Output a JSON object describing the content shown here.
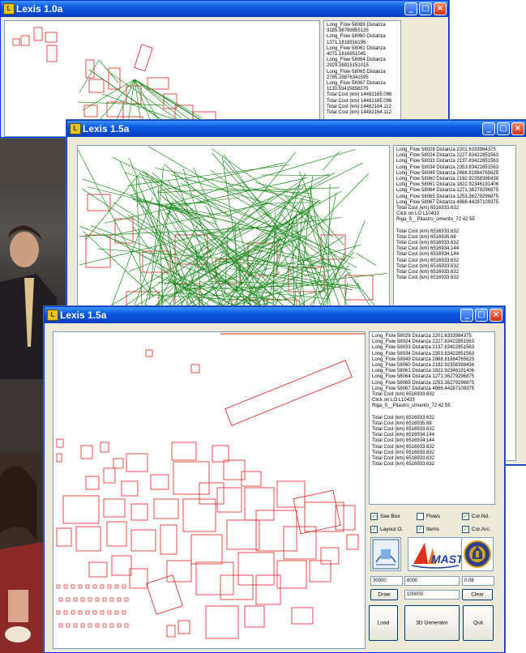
{
  "windows": {
    "w1": {
      "title": "Lexis 1.0a",
      "log": [
        "Long_Flow 58089 Distanza",
        "3185.98799855135",
        "Long_Flow 58060 Distanza",
        "1371.1818916195",
        "Long_Flow 58061 Distanza",
        "4071.1616951045",
        "Long_Flow 58064 Distanza",
        "2929.38815151015",
        "Long_Flow 58065 Distanza",
        "2785.28876341595",
        "Long_Flow 58067 Distanza",
        "1130.53415858375",
        "Total Cost (km) 14482165.096",
        "Total Cost (km) 14482165.096",
        "Total Cost (km) 14482164.112",
        "Total Cost (km) 14482164.112"
      ]
    },
    "w2": {
      "title": "Lexis 1.5a",
      "log": [
        "Long_Flow 58028 Distanza 2201.6333984375",
        "Long_Flow 58024 Distanza 2227.83422851563",
        "Long_Flow 58033 Distanza 2137.83422851563",
        "Long_Flow 58034 Distanza 2353.83422851563",
        "Long_Flow 58049 Distanza 2868.81884765625",
        "Long_Flow 58060 Distanza 2192.92358398438",
        "Long_Flow 58061 Distanza 1822.92346191406",
        "Long_Flow 58064 Distanza 1271.36279296875",
        "Long_Flow 58065 Distanza 1253.36279296875",
        "Long_Flow 58067 Distanza 4866.44287109375",
        "Total Cost (km) 6516933.632",
        "Click on LO L10433",
        "Riga_5__Pilastro_cimento_72 42 55",
        "",
        "Total Cost (km) 6516933.632",
        "Total Cost (km) 6516935.68",
        "Total Cost (km) 6516933.632",
        "Total Cost (km) 6516934.144",
        "Total Cost (km) 6516934.144",
        "Total Cost (km) 6516933.632",
        "Total Cost (km) 6516933.632",
        "Total Cost (km) 6516933.632",
        "Total Cost (km) 6516933.632"
      ]
    },
    "w3": {
      "title": "Lexis 1.5a",
      "log": [
        "Long_Flow 58028 Distanza 2201.6333984375",
        "Long_Flow 58024 Distanza 2227.83422851563",
        "Long_Flow 58033 Distanza 2137.83422851563",
        "Long_Flow 58034 Distanza 2353.83422851563",
        "Long_Flow 58049 Distanza 2868.81884765625",
        "Long_Flow 58060 Distanza 2192.92358398438",
        "Long_Flow 58061 Distanza 1822.92346191406",
        "Long_Flow 58064 Distanza 1271.36279296875",
        "Long_Flow 58065 Distanza 1253.36279296875",
        "Long_Flow 58067 Distanza 4866.44287109375",
        "Total Cost (km) 6516933.632",
        "Click on LO L10433",
        "Riga_5__Pilastro_cimento_72 42 55",
        "",
        "Total Cost (km) 6516933.632",
        "Total Cost (km) 6516935.68",
        "Total Cost (km) 6516933.632",
        "Total Cost (km) 6516934.144",
        "Total Cost (km) 6516934.144",
        "Total Cost (km) 6516933.632",
        "Total Cost (km) 6516933.632",
        "Total Cost (km) 6516933.632",
        "Total Cost (km) 6516933.632"
      ],
      "checkboxes": {
        "see_box": {
          "label": "See Box",
          "checked": true
        },
        "flows": {
          "label": "Flows",
          "checked": false
        },
        "cor_nd": {
          "label": "Cor.Nd.",
          "checked": true
        },
        "layout": {
          "label": "Layout O.",
          "checked": true
        },
        "items": {
          "label": "Items",
          "checked": true
        },
        "cor_arc": {
          "label": "Cor.Arc.",
          "checked": true
        }
      },
      "fields": {
        "f1": "30000",
        "f2": "8000",
        "f3": "0.06",
        "f4": "100000"
      },
      "buttons": {
        "draw": "Draw",
        "clear": "Clear",
        "load": "Load",
        "generator": "3D Generator",
        "quit": "Quit"
      },
      "logos": {
        "logo1": "university-logo",
        "logo2": "mast-logo",
        "logo3": "crest-logo"
      },
      "logo_text": {
        "mast": "MAST"
      }
    }
  },
  "titlebar_buttons": {
    "minimize": "_",
    "maximize": "□",
    "close": "×"
  },
  "colors": {
    "rect_red": "#e02020",
    "flow_green": "#1e8a1e",
    "xp_blue": "#0a58e0"
  }
}
